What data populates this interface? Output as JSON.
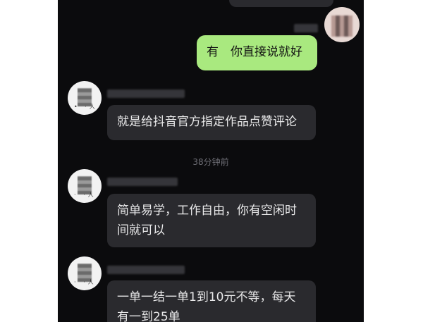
{
  "chat": {
    "messages": [
      {
        "side": "right",
        "text": "有　你直接说就好"
      },
      {
        "side": "left",
        "text": "就是给抖音官方指定作品点赞评论"
      },
      {
        "side": "left",
        "text": "简单易学，工作自由，你有空闲时间就可以"
      },
      {
        "side": "left",
        "text": "一单一结一单1到10元不等，每天有一到25单"
      }
    ],
    "timestamp": "38分钟前"
  },
  "colors": {
    "background": "#0b0b0d",
    "incoming_bubble": "#2a2a2e",
    "outgoing_bubble": "#a9e97f",
    "text_light": "#e9e9ea",
    "timestamp": "#6f6f76"
  }
}
